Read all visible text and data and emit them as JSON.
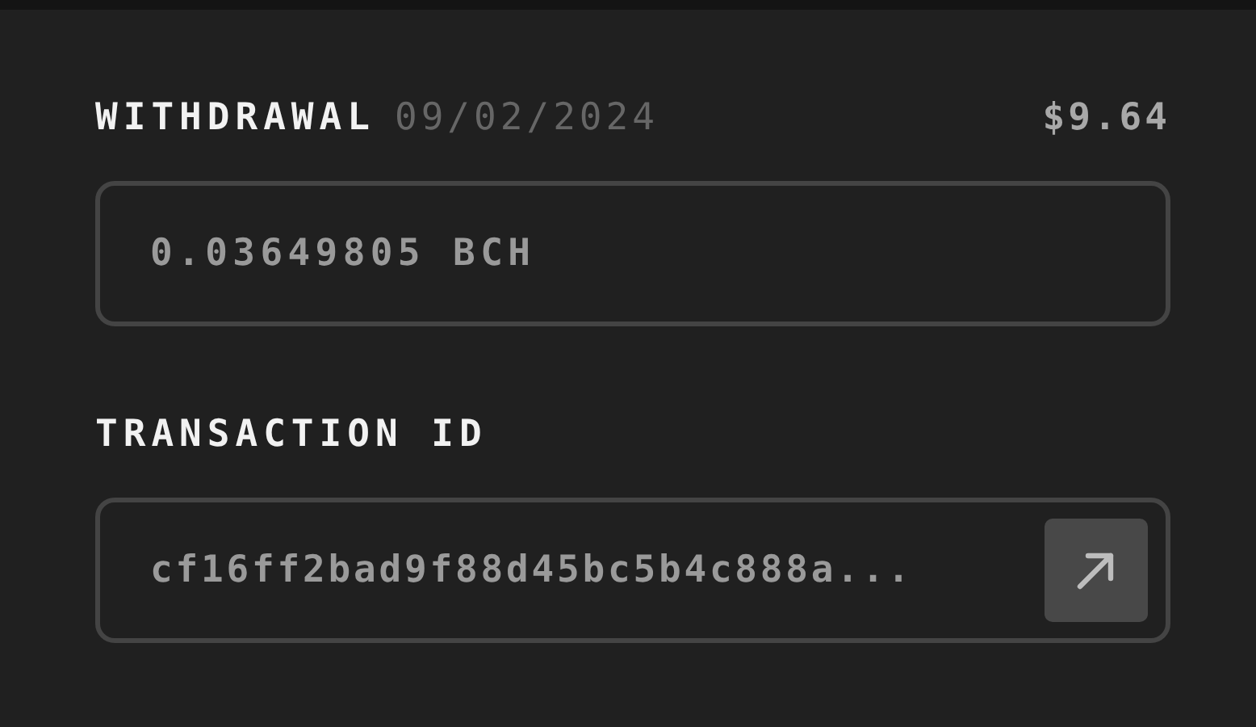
{
  "withdrawal": {
    "label": "WITHDRAWAL",
    "date": "09/02/2024",
    "usd_value": "$9.64",
    "amount": "0.03649805 BCH"
  },
  "transaction": {
    "label": "TRANSACTION ID",
    "id": "cf16ff2bad9f88d45bc5b4c888a..."
  }
}
